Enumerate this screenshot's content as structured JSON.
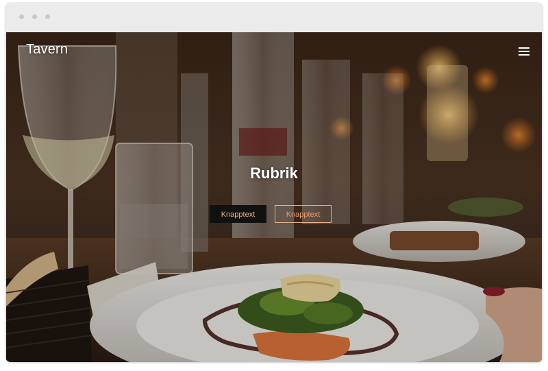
{
  "site": {
    "logo": "Tavern"
  },
  "header": {
    "menu_icon": "hamburger-menu-icon"
  },
  "hero": {
    "title": "Rubrik",
    "primary_button": "Knapptext",
    "secondary_button": "Knapptext",
    "image": "restaurant-table-with-plated-dish-and-glasses"
  },
  "colors": {
    "button_primary_bg": "#111111",
    "button_primary_text": "#f0b486",
    "button_secondary_border": "#e9b48d",
    "button_secondary_text": "#f0a06b",
    "text_light": "#ffffff",
    "window_chrome": "#ebebeb"
  }
}
